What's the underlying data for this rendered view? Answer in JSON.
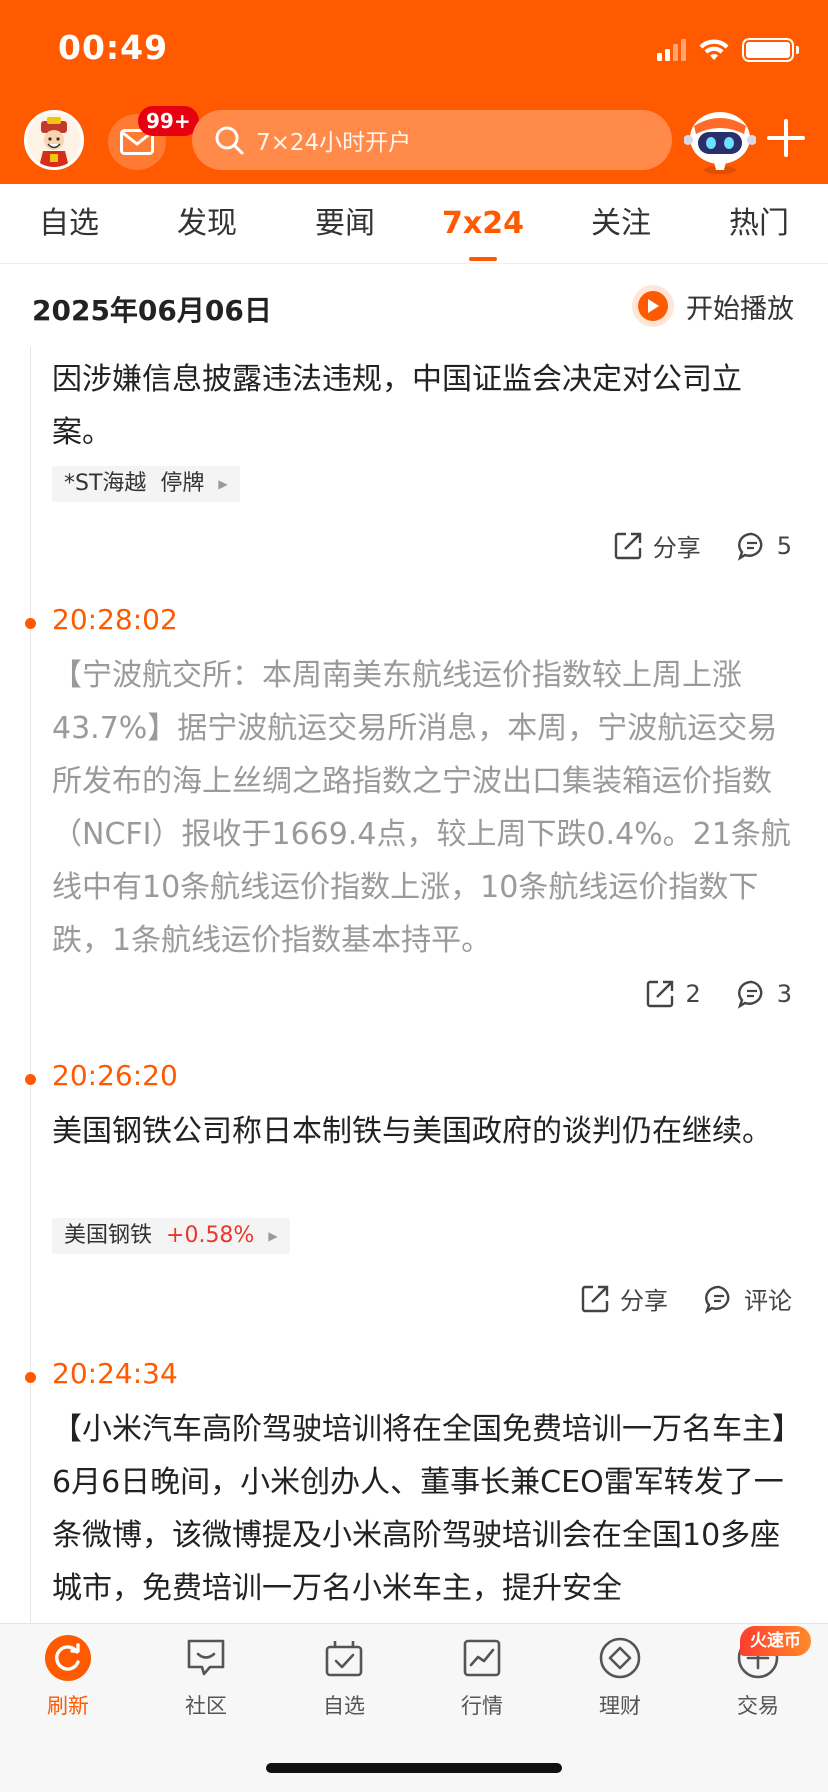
{
  "status_bar": {
    "time": "00:49"
  },
  "header": {
    "mail_badge": "99+",
    "search_placeholder": "7×24小时开户"
  },
  "tabs": [
    {
      "label": "自选"
    },
    {
      "label": "发现"
    },
    {
      "label": "要闻"
    },
    {
      "label": "7x24"
    },
    {
      "label": "关注"
    },
    {
      "label": "热门"
    }
  ],
  "active_tab": "7x24",
  "date_bar": {
    "date": "2025年06月06日",
    "play_label": "开始播放"
  },
  "feed": [
    {
      "time": "",
      "text": "因涉嫌信息披露违法违规，中国证监会决定对公司立案。",
      "stock": {
        "name": "*ST海越",
        "status": "停牌"
      },
      "share_label": "分享",
      "comment_label": "5"
    },
    {
      "time": "20:28:02",
      "text": "【宁波航交所：本周南美东航线运价指数较上周上涨43.7%】据宁波航运交易所消息，本周，宁波航运交易所发布的海上丝绸之路指数之宁波出口集装箱运价指数（NCFI）报收于1669.4点，较上周下跌0.4%。21条航线中有10条航线运价指数上涨，10条航线运价指数下跌，1条航线运价指数基本持平。",
      "share_label": "2",
      "comment_label": "3"
    },
    {
      "time": "20:26:20",
      "text": "美国钢铁公司称日本制铁与美国政府的谈判仍在继续。",
      "stock": {
        "name": "美国钢铁",
        "change": "+0.58%"
      },
      "share_label": "分享",
      "comment_label": "评论"
    },
    {
      "time": "20:24:34",
      "text": "【小米汽车高阶驾驶培训将在全国免费培训一万名车主】6月6日晚间，小米创办人、董事长兼CEO雷军转发了一条微博，该微博提及小米高阶驾驶培训会在全国10多座城市，免费培训一万名小米车主，提升安全"
    }
  ],
  "bottom_nav": [
    {
      "label": "刷新",
      "icon": "refresh-icon"
    },
    {
      "label": "社区",
      "icon": "community-icon"
    },
    {
      "label": "自选",
      "icon": "watchlist-icon"
    },
    {
      "label": "行情",
      "icon": "market-icon"
    },
    {
      "label": "理财",
      "icon": "wealth-icon"
    },
    {
      "label": "交易",
      "icon": "trade-icon"
    }
  ],
  "hot_badge": "火速币",
  "colors": {
    "brand": "#ff5a00",
    "up": "#e8382b"
  }
}
